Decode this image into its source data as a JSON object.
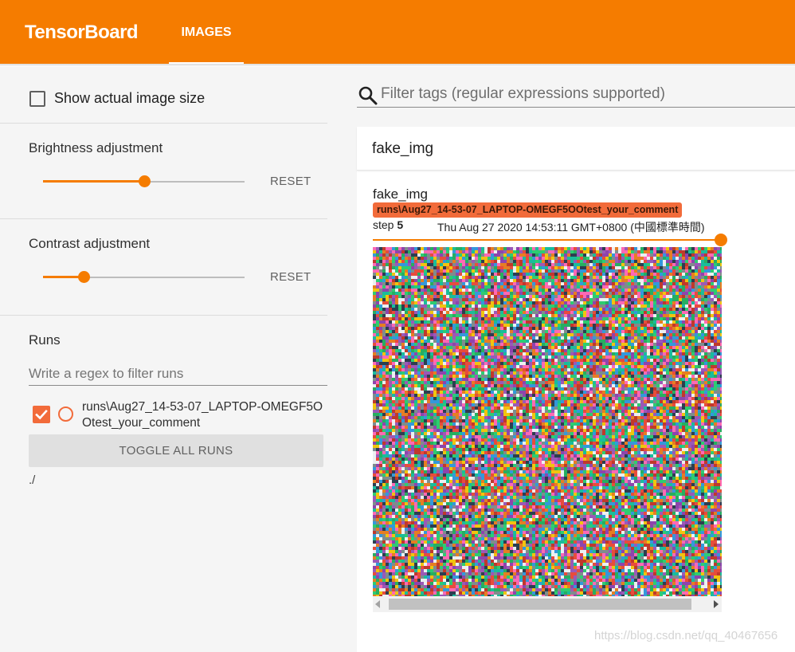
{
  "header": {
    "app_title": "TensorBoard",
    "tabs": [
      {
        "label": "IMAGES",
        "active": true
      }
    ]
  },
  "theme": {
    "accent": "#f57c00",
    "run_color": "#f26b3a",
    "sidebar_bg": "#f5f5f5"
  },
  "sidebar": {
    "show_actual_size": {
      "label": "Show actual image size",
      "checked": false
    },
    "brightness": {
      "label": "Brightness adjustment",
      "value_fraction": 0.5,
      "reset_label": "RESET"
    },
    "contrast": {
      "label": "Contrast adjustment",
      "value_fraction": 0.2,
      "reset_label": "RESET"
    },
    "runs": {
      "title": "Runs",
      "filter_placeholder": "Write a regex to filter runs",
      "items": [
        {
          "name": "runs\\Aug27_14-53-07_LAPTOP-OMEGF5OOtest_your_comment",
          "checked": true
        }
      ],
      "toggle_all_label": "TOGGLE ALL RUNS",
      "logdir": "./"
    }
  },
  "main": {
    "filter_placeholder": "Filter tags (regular expressions supported)",
    "category": {
      "title": "fake_img",
      "cards": [
        {
          "tag": "fake_img",
          "run": "runs\\Aug27_14-53-07_LAPTOP-OMEGF5OOtest_your_comment",
          "step_prefix": "step",
          "step": "5",
          "timestamp": "Thu Aug 27 2020 14:53:11 GMT+0800 (中國標準時間)",
          "step_fraction": 1.0
        }
      ]
    }
  },
  "watermark": "https://blog.csdn.net/qq_40467656",
  "icons": [
    "search-icon",
    "checkbox-icon",
    "radio-icon",
    "scroll-left-arrow-icon",
    "scroll-right-arrow-icon"
  ]
}
